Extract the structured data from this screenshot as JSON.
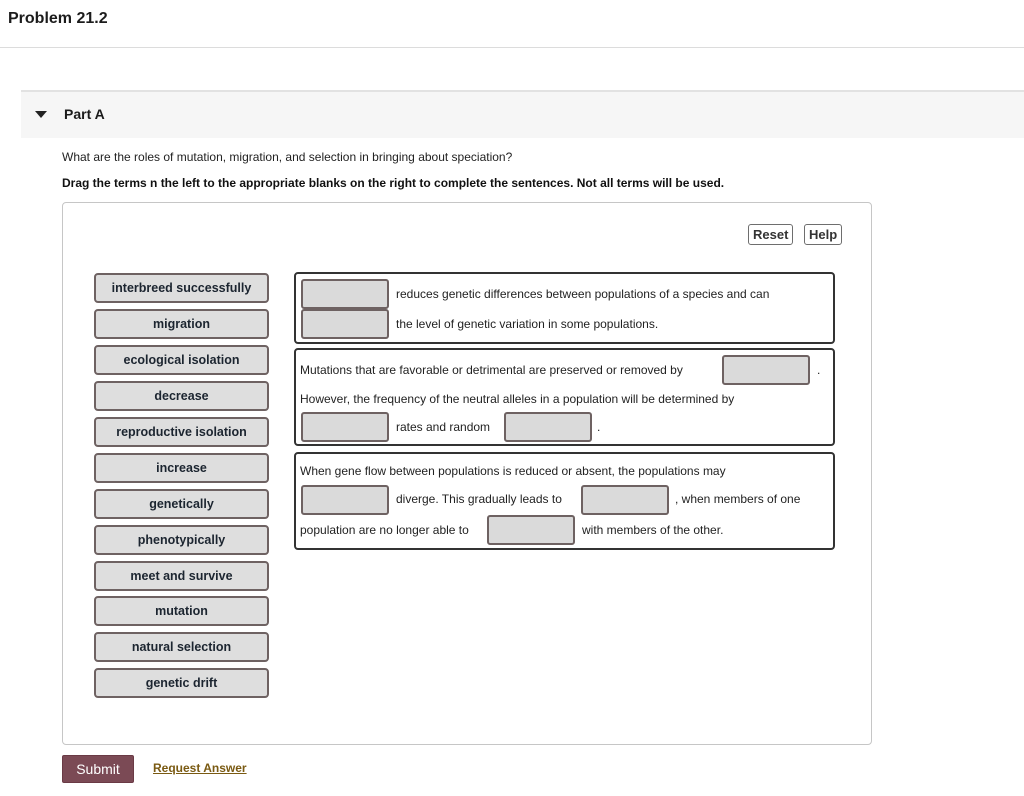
{
  "problem": {
    "title": "Problem 21.2"
  },
  "part": {
    "label": "Part A",
    "caret_icon": "caret-down-icon",
    "expanded": true
  },
  "question": "What are the roles of mutation, migration, and selection in bringing about speciation?",
  "instruction": "Drag the terms n the left to the appropriate blanks on the right to complete the sentences. Not all terms will be used.",
  "toolbar": {
    "reset_label": "Reset",
    "help_label": "Help"
  },
  "terms": [
    "interbreed successfully",
    "migration",
    "ecological isolation",
    "decrease",
    "reproductive isolation",
    "increase",
    "genetically",
    "phenotypically",
    "meet and survive",
    "mutation",
    "natural selection",
    "genetic drift"
  ],
  "sentences": [
    {
      "segments": [
        "reduces genetic differences between populations of a species and can",
        "the level of genetic variation in some populations."
      ],
      "blanks": [
        "",
        ""
      ]
    },
    {
      "segments": [
        "Mutations that are favorable or detrimental are preserved or removed by",
        ".",
        "However, the frequency of the neutral alleles in a population will be determined by",
        "rates and random",
        "."
      ],
      "blanks": [
        "",
        "",
        ""
      ]
    },
    {
      "segments": [
        "When gene flow between populations is reduced or absent, the populations may",
        "diverge. This gradually leads to",
        ", when members of one",
        "population are no longer able to",
        "with members of the other."
      ],
      "blanks": [
        "",
        "",
        ""
      ]
    }
  ],
  "actions": {
    "submit_label": "Submit",
    "request_answer_label": "Request Answer"
  },
  "colors": {
    "submit_bg": "#7b4a55",
    "link": "#7a5a12",
    "term_bg": "#dedede",
    "blank_bg": "#dadada"
  }
}
